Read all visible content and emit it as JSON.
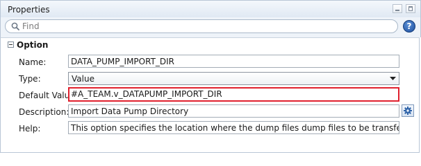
{
  "titlebar": {
    "title": "Properties"
  },
  "search": {
    "placeholder": "Find",
    "value": ""
  },
  "section": {
    "title": "Option"
  },
  "fields": {
    "name": {
      "label": "Name:",
      "value": "DATA_PUMP_IMPORT_DIR"
    },
    "type": {
      "label": "Type:",
      "value": "Value"
    },
    "default_value": {
      "label": "Default Value:",
      "value": "#A_TEAM.v_DATAPUMP_IMPORT_DIR"
    },
    "description": {
      "label": "Description:",
      "value": "Import Data Pump Directory"
    },
    "help": {
      "label": "Help:",
      "value": "This option specifies the location where the dump files dump files to be transferred after the datap"
    }
  },
  "icons": {
    "search": "search-icon",
    "help": "help-icon",
    "collapse": "collapse-icon",
    "dropdown": "chevron-down-icon",
    "edit": "gear-icon",
    "minimize": "minimize-icon",
    "maximize": "maximize-icon"
  },
  "colors": {
    "highlight_border": "#e0202e",
    "help_icon": "#1d4f9e",
    "titlebar": "#dfe8f3"
  }
}
